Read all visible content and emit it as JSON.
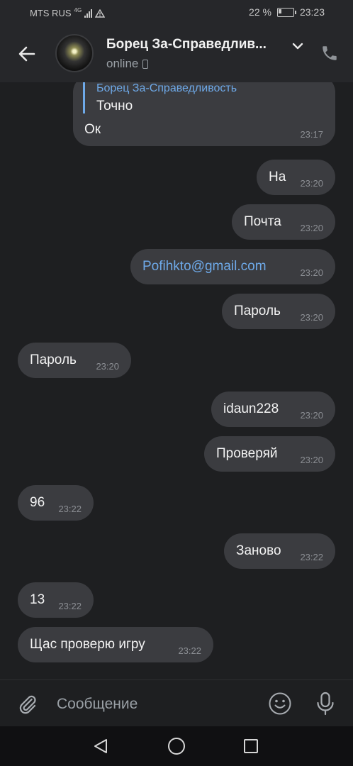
{
  "status_bar": {
    "carrier": "MTS RUS",
    "network": "4G",
    "battery": "22 %",
    "battery_level": 0.22,
    "time": "23:23"
  },
  "header": {
    "title": "Борец За-Справедлив...",
    "status": "online"
  },
  "quoted_message": {
    "author": "Борец За-Справедливость",
    "quote": "Точно",
    "text": "Ок",
    "time": "23:17"
  },
  "messages": [
    {
      "text": "На",
      "time": "23:20",
      "outgoing": true
    },
    {
      "text": "Почта",
      "time": "23:20",
      "outgoing": true
    },
    {
      "text": "Pofihkto@gmail.com",
      "time": "23:20",
      "outgoing": true
    },
    {
      "text": "Пароль",
      "time": "23:20",
      "outgoing": true
    },
    {
      "text": "Пароль",
      "time": "23:20",
      "outgoing": false
    },
    {
      "text": "idaun228",
      "time": "23:20",
      "outgoing": true
    },
    {
      "text": "Проверяй",
      "time": "23:20",
      "outgoing": true
    },
    {
      "text": "96",
      "time": "23:22",
      "outgoing": false
    },
    {
      "text": "Заново",
      "time": "23:22",
      "outgoing": true
    },
    {
      "text": "13",
      "time": "23:22",
      "outgoing": false
    },
    {
      "text": "Щас проверю игру",
      "time": "23:22",
      "outgoing": false
    }
  ],
  "composer": {
    "placeholder": "Сообщение"
  },
  "icons": {
    "back": "arrow-left-icon",
    "chevron": "chevron-down-icon",
    "call": "phone-icon",
    "attach": "paperclip-icon",
    "emoji": "smiley-icon",
    "mic": "microphone-icon"
  },
  "colors": {
    "background": "#1e1f21",
    "bubble": "#3b3c40",
    "accent": "#6ea9e8"
  }
}
